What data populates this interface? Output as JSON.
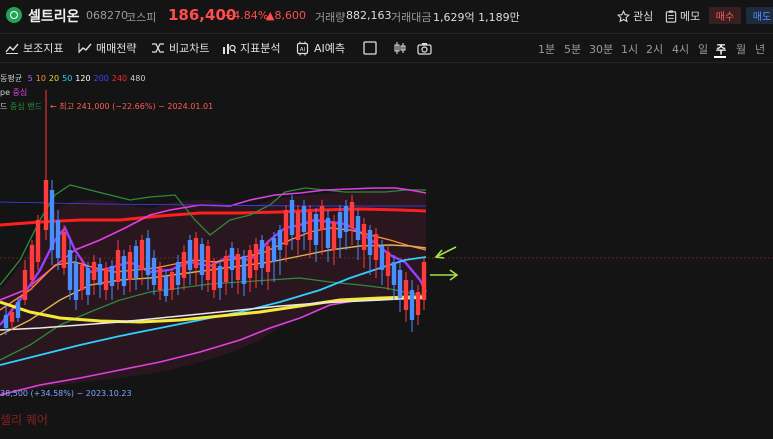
{
  "header": {
    "stock_name": "셀트리온",
    "stock_code": "068270",
    "market": "코스피",
    "price": "186,400",
    "change_pct": "+4.84%",
    "change_amt": "▲8,600",
    "volume_label": "거래량",
    "volume_value": "882,163",
    "amount_label": "거래대금",
    "amount_value": "1,629억 1,189만",
    "favorite_label": "관심",
    "memo_label": "메모",
    "buy_label": "매수",
    "sell_label": "매도"
  },
  "toolbar": {
    "tools": [
      "보조지표",
      "매매전략",
      "비교차트",
      "지표분석",
      "AI예측"
    ],
    "periods": [
      "1분",
      "5분",
      "30분",
      "1시",
      "2시",
      "4시",
      "일",
      "주",
      "월",
      "년"
    ],
    "active_period": "주"
  },
  "legends": {
    "ma_label": "동평균",
    "ma_periods": [
      "5",
      "10",
      "20",
      "50",
      "120",
      "200",
      "240",
      "480"
    ],
    "ma_colors": [
      "#b05cff",
      "#ff8a3d",
      "#f0d23c",
      "#2fd0ff",
      "#ffffff",
      "#3a45ff",
      "#ff2a2a",
      "#cfcfcf"
    ],
    "envelope_label": "pe",
    "envelope_center": "중심",
    "band_label": "드",
    "band_center": "중심",
    "band_suffix": "밴드",
    "high_annotation": "← 최고 241,000 (−22.66%) − 2024.01.01",
    "low_annotation": "38,500 (+34.58%) − 2023.10.23",
    "watermark": "셀리 퀘어"
  },
  "colors": {
    "up": "#ff3b3b",
    "down": "#4a8dff",
    "accent_green": "#a4e04a",
    "magenta_line": "#e040e0",
    "green_band": "#2e8b3a"
  }
}
